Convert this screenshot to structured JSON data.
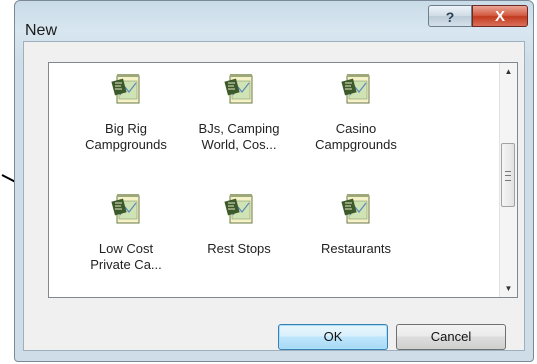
{
  "dialog": {
    "title": "New",
    "help_glyph": "?",
    "close_glyph": "X"
  },
  "list": {
    "items": [
      {
        "label": "Big Rig\nCampgrounds",
        "icon": "map-template-icon"
      },
      {
        "label": "BJs, Camping\nWorld, Cos...",
        "icon": "map-template-icon"
      },
      {
        "label": "Casino\nCampgrounds",
        "icon": "map-template-icon"
      },
      {
        "label": "Low Cost\nPrivate Ca...",
        "icon": "map-template-icon"
      },
      {
        "label": "Rest Stops",
        "icon": "map-template-icon"
      },
      {
        "label": "Restaurants",
        "icon": "map-template-icon"
      }
    ]
  },
  "buttons": {
    "ok": "OK",
    "cancel": "Cancel"
  },
  "colors": {
    "close_button": "#c23a1e",
    "ok_focus": "#3c7fb1"
  }
}
